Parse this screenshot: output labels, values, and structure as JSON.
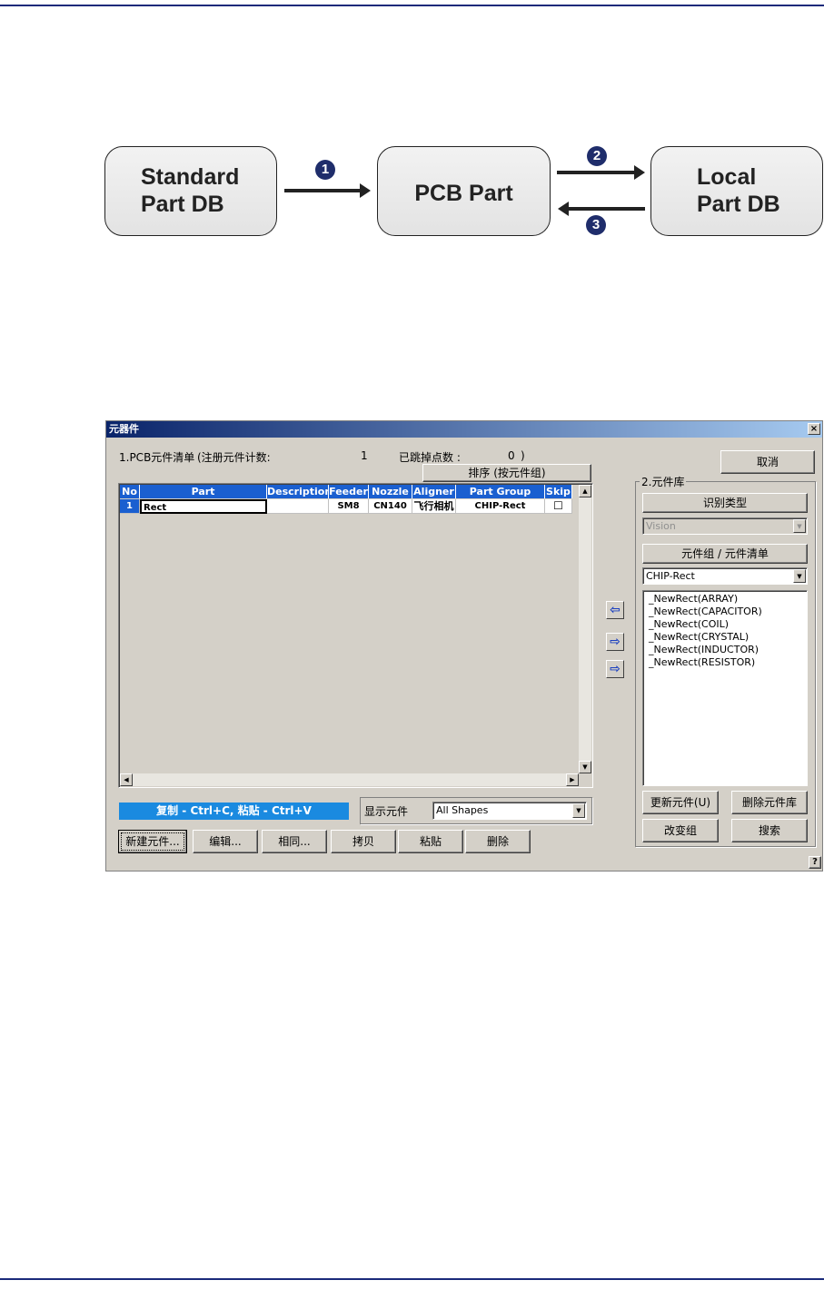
{
  "diagram": {
    "standard_db": [
      "Standard",
      "Part DB"
    ],
    "pcb_part": "PCB Part",
    "local_db": [
      "Local",
      "Part DB"
    ],
    "step1": "1",
    "step2": "2",
    "step3": "3"
  },
  "dialog": {
    "title": "元器件",
    "close": "×",
    "pcb_list_label": "1.PCB元件清单",
    "registered_count_label": "(注册元件计数:",
    "registered_count": "1",
    "skipped_label": "已跳掉点数 :",
    "skipped_count": "0",
    "close_paren": ")",
    "sort_button": "排序 (按元件组)",
    "cancel_button": "取消",
    "table": {
      "columns": [
        "No",
        "Part",
        "Description",
        "Feeder",
        "Nozzle",
        "Aligner",
        "Part Group",
        "Skip"
      ],
      "rows": [
        {
          "no": "1",
          "part": "Rect",
          "description": "",
          "feeder": "SM8",
          "nozzle": "CN140",
          "aligner": "飞行相机",
          "part_group": "CHIP-Rect",
          "skip": "☐"
        }
      ]
    },
    "copy_hint": "复制 - Ctrl+C, 粘贴 - Ctrl+V",
    "show_parts_label": "显示元件",
    "show_parts_value": "All Shapes",
    "bottom_buttons": [
      "新建元件...",
      "编辑...",
      "相同...",
      "拷贝",
      "粘贴",
      "删除"
    ],
    "library": {
      "group_label": "2.元件库",
      "recognition_type_label": "识别类型",
      "recognition_type_value": "Vision",
      "group_list_label": "元件组 / 元件清单",
      "group_value": "CHIP-Rect",
      "items": [
        "_NewRect(ARRAY)",
        "_NewRect(CAPACITOR)",
        "_NewRect(COIL)",
        "_NewRect(CRYSTAL)",
        "_NewRect(INDUCTOR)",
        "_NewRect(RESISTOR)"
      ],
      "update_button": "更新元件(U)",
      "delete_button": "删除元件库",
      "change_group_button": "改变组",
      "search_button": "搜索"
    },
    "transfer": {
      "to_pcb": "⇦",
      "to_library": "⇨",
      "to_library_all": "⇨"
    },
    "help": "?"
  },
  "colors": {
    "header_blue": "#1a5fd0",
    "title_start": "#0a246a",
    "badge": "#1f2d6b"
  }
}
